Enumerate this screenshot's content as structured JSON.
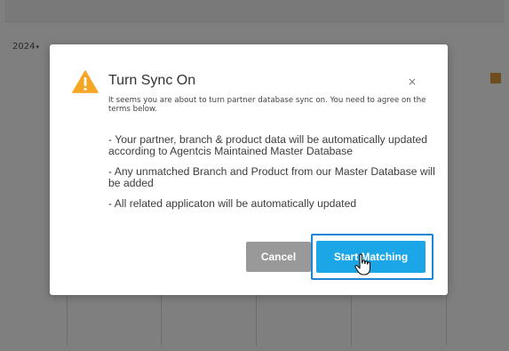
{
  "background": {
    "year_select": "2024",
    "colors": {
      "accent_square": "#e09a3a"
    }
  },
  "modal": {
    "title": "Turn Sync On",
    "icon": "warning-icon",
    "close_symbol": "×",
    "subtitle": "It seems you are about to turn partner database sync on. You need to agree on the terms below.",
    "bullets": [
      "- Your partner, branch & product data will be automatically updated according to Agentcis Maintained Master Database",
      "- Any unmatched Branch and Product from our Master Database will be added",
      "- All related applicaton will be automatically updated"
    ],
    "buttons": {
      "cancel_label": "Cancel",
      "start_label": "Start Matching"
    },
    "colors": {
      "primary": "#1ba6e8",
      "cancel": "#999999",
      "warning": "#f5a623",
      "highlight": "#1a85d6"
    }
  },
  "cursor": {
    "type": "hand-pointer"
  }
}
